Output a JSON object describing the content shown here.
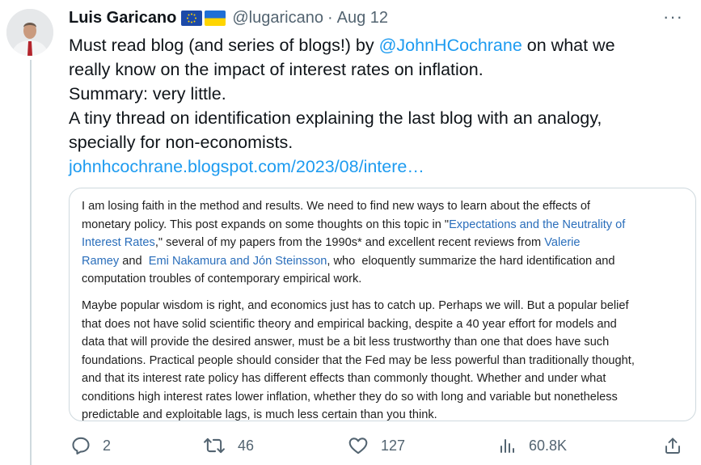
{
  "author": {
    "name": "Luis Garicano",
    "handle": "@lugaricano",
    "separator": "·",
    "date": "Aug 12",
    "flags": [
      "eu-flag-icon",
      "ukraine-flag-icon"
    ]
  },
  "tweet": {
    "line1_pre": "Must read blog (and series of blogs!) by ",
    "mention": "@JohnHCochrane",
    "line1_post": " on what we",
    "line2": "really know on the impact of interest rates on inflation.",
    "line3": "Summary: very little.",
    "line4": "A tiny thread on identification explaining the last blog with an analogy,",
    "line5": "specially for non-economists.",
    "url": "johnhcochrane.blogspot.com/2023/08/intere…"
  },
  "quote": {
    "p1": {
      "l1": "I am losing faith in the method and results. We need to find new ways to learn about the effects of",
      "l2_pre": "monetary policy. This post expands on some thoughts on this topic in \"",
      "l2_link": "Expectations and the Neutrality of",
      "l3_link": "Interest Rates",
      "l3_post": ",\" several of my papers from the 1990s* and excellent recent reviews from ",
      "l3_link2": "Valerie",
      "l4_link": "Ramey",
      "l4_mid": " and  ",
      "l4_link2": "Emi Nakamura and Jón Steinsson",
      "l4_post": ", who  eloquently summarize the hard identification and",
      "l5": "computation troubles of contemporary empirical work."
    },
    "p2": [
      "Maybe popular wisdom is right, and economics just has to catch up. Perhaps we will. But a popular belief",
      "that does not have solid scientific theory and empirical backing, despite a 40 year effort for models and",
      "data that will provide the desired answer, must be a bit less trustworthy than one that does have such",
      "foundations. Practical people should consider that the Fed may be less powerful than traditionally thought,",
      "and that its interest rate policy has different effects than commonly thought. Whether and under what",
      "conditions high interest rates lower inflation, whether they do so with long and variable but nonetheless",
      "predictable and exploitable lags, is much less certain than you think."
    ]
  },
  "actions": {
    "replies": "2",
    "retweets": "46",
    "likes": "127",
    "views": "60.8K"
  },
  "colors": {
    "link": "#1d9bf0",
    "muted": "#536471",
    "text": "#0f1419",
    "border": "#cfd9de",
    "quote_link": "#2a6ebb"
  }
}
